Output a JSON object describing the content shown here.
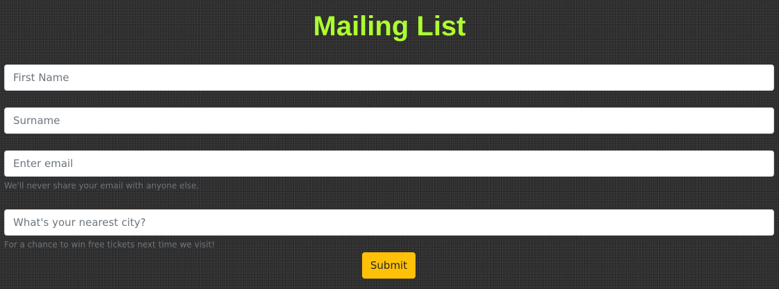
{
  "page": {
    "title": "Mailing List"
  },
  "form": {
    "first_name": {
      "placeholder": "First Name",
      "value": ""
    },
    "surname": {
      "placeholder": "Surname",
      "value": ""
    },
    "email": {
      "placeholder": "Enter email",
      "value": "",
      "help": "We'll never share your email with anyone else."
    },
    "city": {
      "placeholder": "What's your nearest city?",
      "value": "",
      "help": "For a chance to win free tickets next time we visit!"
    },
    "submit_label": "Submit"
  },
  "colors": {
    "title": "#adff2f",
    "submit_background": "#ffc107",
    "help_text": "#6c757d"
  }
}
